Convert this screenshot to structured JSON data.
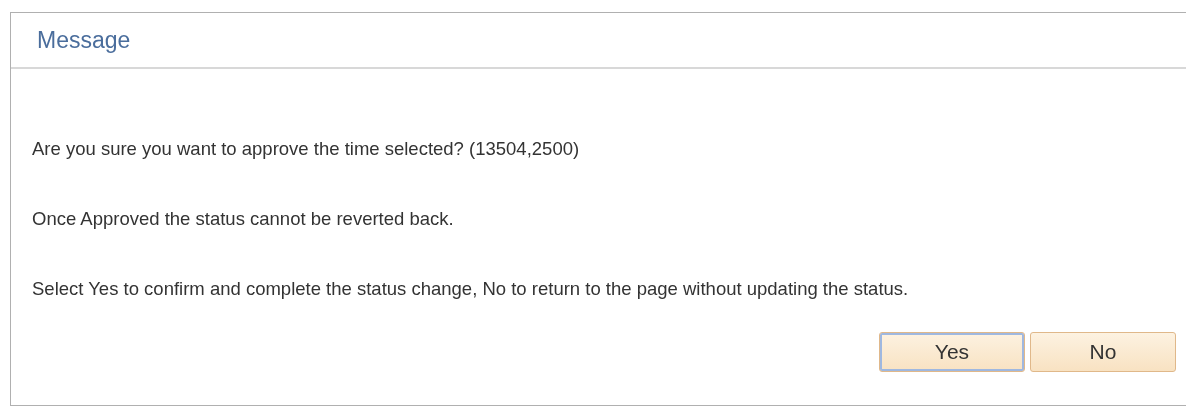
{
  "dialog": {
    "title": "Message",
    "paragraphs": [
      "Are you sure you want to approve the time selected? (13504,2500)",
      "Once Approved the status cannot be reverted back.",
      "Select Yes to confirm and complete the status change, No to return to the page without updating the status."
    ],
    "buttons": [
      {
        "label": "Yes",
        "focused": true
      },
      {
        "label": "No",
        "focused": false
      }
    ]
  }
}
